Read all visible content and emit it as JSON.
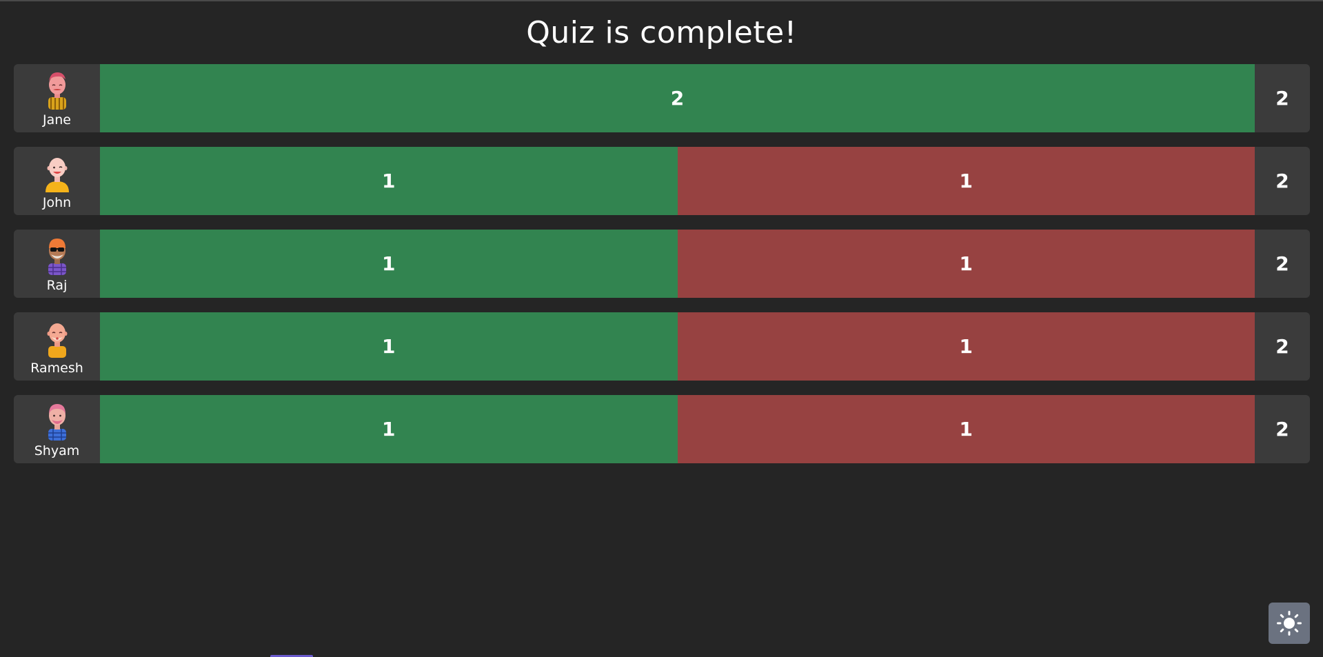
{
  "page": {
    "title": "Quiz is complete!"
  },
  "colors": {
    "background": "#252525",
    "row_background": "#3b3b3b",
    "correct": "#328450",
    "wrong": "#974241",
    "toggle": "#6b7280"
  },
  "results": [
    {
      "name": "Jane",
      "avatar": "avatar-jane-icon",
      "correct": 2,
      "wrong": 0,
      "total": 2
    },
    {
      "name": "John",
      "avatar": "avatar-john-icon",
      "correct": 1,
      "wrong": 1,
      "total": 2
    },
    {
      "name": "Raj",
      "avatar": "avatar-raj-icon",
      "correct": 1,
      "wrong": 1,
      "total": 2
    },
    {
      "name": "Ramesh",
      "avatar": "avatar-ramesh-icon",
      "correct": 1,
      "wrong": 1,
      "total": 2
    },
    {
      "name": "Shyam",
      "avatar": "avatar-shyam-icon",
      "correct": 1,
      "wrong": 1,
      "total": 2
    }
  ],
  "theme_toggle": {
    "icon": "sun-icon"
  }
}
